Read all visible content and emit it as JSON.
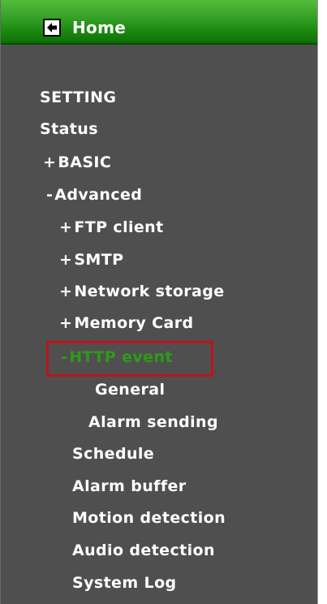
{
  "header": {
    "home_label": "Home",
    "home_icon": "arrow-left-icon"
  },
  "menu": {
    "setting": "SETTING",
    "status": "Status",
    "basic": {
      "sign": "+",
      "label": "BASIC"
    },
    "advanced": {
      "sign": "-",
      "label": "Advanced"
    },
    "ftp_client": {
      "sign": "+",
      "label": "FTP client"
    },
    "smtp": {
      "sign": "+",
      "label": "SMTP"
    },
    "network_storage": {
      "sign": "+",
      "label": "Network storage"
    },
    "memory_card": {
      "sign": "+",
      "label": "Memory Card"
    },
    "http_event": {
      "sign": "-",
      "label": "HTTP event"
    },
    "general": "General",
    "alarm_sending": "Alarm sending",
    "schedule": "Schedule",
    "alarm_buffer": "Alarm buffer",
    "motion_detection": "Motion detection",
    "audio_detection": "Audio detection",
    "system_log": "System Log"
  },
  "colors": {
    "panel_bg": "#4f4f4f",
    "header_green": "#1c8a12",
    "active_text": "#2d9b17",
    "highlight_border": "#c1121c"
  }
}
